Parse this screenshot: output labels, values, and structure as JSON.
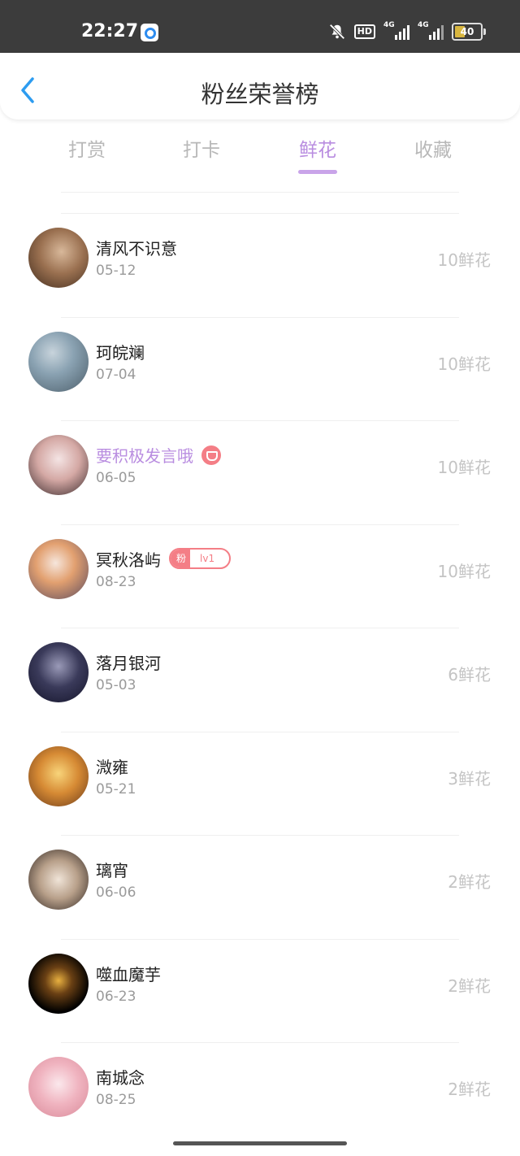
{
  "status_bar": {
    "time": "22:27",
    "hd_label": "HD",
    "signal1_label": "4G",
    "signal2_label": "4G",
    "battery": "40",
    "battery_level": 0.4
  },
  "header": {
    "title": "粉丝荣誉榜"
  },
  "tabs": [
    {
      "label": "打赏",
      "active": false
    },
    {
      "label": "打卡",
      "active": false
    },
    {
      "label": "鲜花",
      "active": true
    },
    {
      "label": "收藏",
      "active": false
    }
  ],
  "fans": [
    {
      "name": "清风不识意",
      "date": "05-12",
      "count": "10鲜花"
    },
    {
      "name": "珂皖斓",
      "date": "07-04",
      "count": "10鲜花"
    },
    {
      "name": "要积极发言哦",
      "date": "06-05",
      "count": "10鲜花",
      "vip": true
    },
    {
      "name": "冥秋洛屿",
      "date": "08-23",
      "count": "10鲜花",
      "fan_badge": {
        "label": "粉",
        "level": "lv1"
      }
    },
    {
      "name": "落月银河",
      "date": "05-03",
      "count": "6鲜花"
    },
    {
      "name": "溦雍",
      "date": "05-21",
      "count": "3鲜花"
    },
    {
      "name": "璃宵",
      "date": "06-06",
      "count": "2鲜花"
    },
    {
      "name": "噬血魔芋",
      "date": "06-23",
      "count": "2鲜花"
    },
    {
      "name": "南城念",
      "date": "08-25",
      "count": "2鲜花"
    }
  ],
  "colors": {
    "accent": "#b98de0",
    "badge": "#f47e86",
    "status_bar": "#3c3c3c"
  }
}
